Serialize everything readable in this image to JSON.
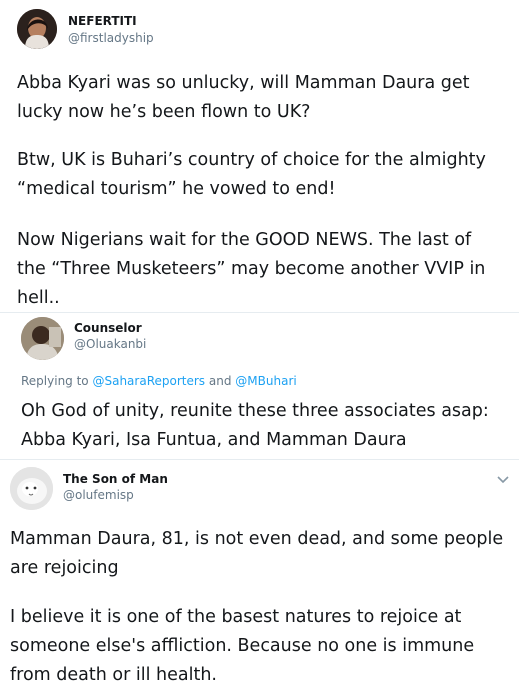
{
  "tweet1": {
    "name": "NEFERTITI",
    "handle": "@firstladyship",
    "paragraph1": "Abba Kyari was so unlucky, will Mamman Daura get\nlucky now he’s been flown to UK?",
    "paragraph2": "Btw, UK is Buhari’s country of choice for the almighty\n“medical tourism” he vowed to end!",
    "paragraph3": "Now Nigerians wait for the GOOD NEWS. The last of\nthe “Three Musketeers” may become another VVIP in\nhell.."
  },
  "tweet2": {
    "name": "Counselor",
    "handle": "@Oluakanbi",
    "replying_prefix": "Replying to",
    "mention1": "@SaharaReporters",
    "and": "and",
    "mention2": "@MBuhari",
    "text": "Oh God of unity, reunite these three associates asap:\nAbba Kyari, Isa Funtua, and Mamman Daura"
  },
  "tweet3": {
    "name": "The Son of Man",
    "handle": "@olufemisp",
    "paragraph1": "Mamman Daura, 81, is not even dead, and some people\nare rejoicing",
    "paragraph2": "I believe it is one of the basest natures to rejoice at\nsomeone else's affliction. Because no one is immune\nfrom death or ill health."
  },
  "icons": {
    "more": "chevron-down-icon"
  }
}
